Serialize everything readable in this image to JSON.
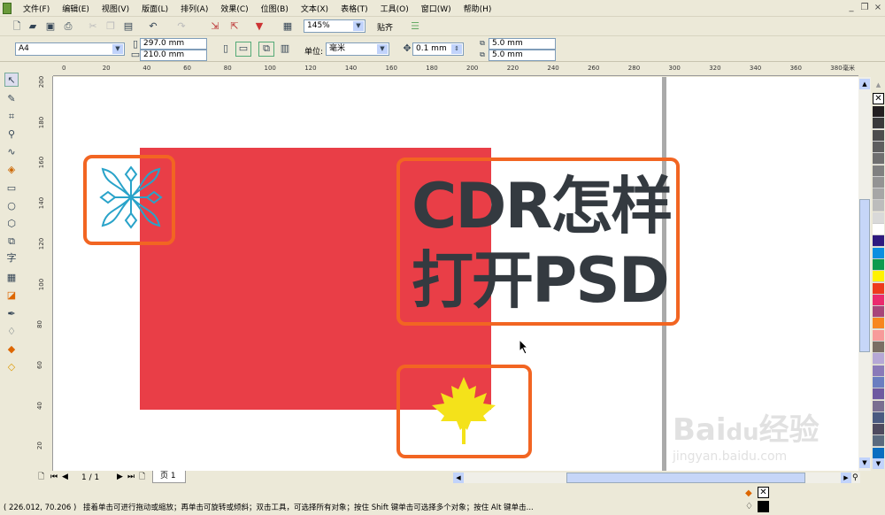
{
  "menu": [
    "文件(F)",
    "编辑(E)",
    "视图(V)",
    "版面(L)",
    "排列(A)",
    "效果(C)",
    "位图(B)",
    "文本(X)",
    "表格(T)",
    "工具(O)",
    "窗口(W)",
    "帮助(H)"
  ],
  "window_controls": {
    "minimize": "_",
    "restore": "❐",
    "close": "×"
  },
  "toolbar": {
    "zoom": "145%",
    "snap": "贴齐"
  },
  "property_bar": {
    "paper": "A4",
    "width": "297.0 mm",
    "height": "210.0 mm",
    "unit_label": "单位:",
    "unit": "毫米",
    "nudge": "0.1 mm",
    "dup_x": "5.0 mm",
    "dup_y": "5.0 mm"
  },
  "hruler_ticks": [
    "0",
    "20",
    "40",
    "60",
    "80",
    "100",
    "120",
    "140",
    "160",
    "180",
    "200",
    "220",
    "240",
    "260",
    "280",
    "300",
    "320",
    "340",
    "360",
    "380"
  ],
  "hruler_unit": "毫米",
  "vruler_ticks": [
    "200",
    "180",
    "160",
    "140",
    "120",
    "100",
    "80",
    "60",
    "40",
    "20"
  ],
  "canvas": {
    "line1": "CDR怎样",
    "line2": "打开PSD"
  },
  "pagebar": {
    "page_count": "1 / 1",
    "page_tab": "页 1"
  },
  "status": {
    "coords": "( 226.012, 70.206 )",
    "hint": "接着单击可进行拖动或缩放；再单击可旋转或倾斜；双击工具，可选择所有对象；按住 Shift 键单击可选择多个对象；按住 Alt 键单击..."
  },
  "palette": [
    "#231f20",
    "#3a3a3a",
    "#4d4d4d",
    "#5e5e5e",
    "#6f6f6f",
    "#808080",
    "#939393",
    "#a6a6a6",
    "#bcbcbc",
    "#d9d9d9",
    "#ffffff",
    "#2e1a7f",
    "#0a8fe0",
    "#0c9a4e",
    "#fff200",
    "#ee3a1c",
    "#ea2a6e",
    "#a8457a",
    "#f7861e",
    "#f79a9a",
    "#7a6e64",
    "#b6a8d6",
    "#8a7ab8",
    "#6a7ec0",
    "#6e5aa0",
    "#7a6e90",
    "#4a5a80",
    "#4e4a5e",
    "#5a6a7e",
    "#0a6ec0"
  ],
  "watermark": "Baidu经验 jingyan.baidu.com"
}
